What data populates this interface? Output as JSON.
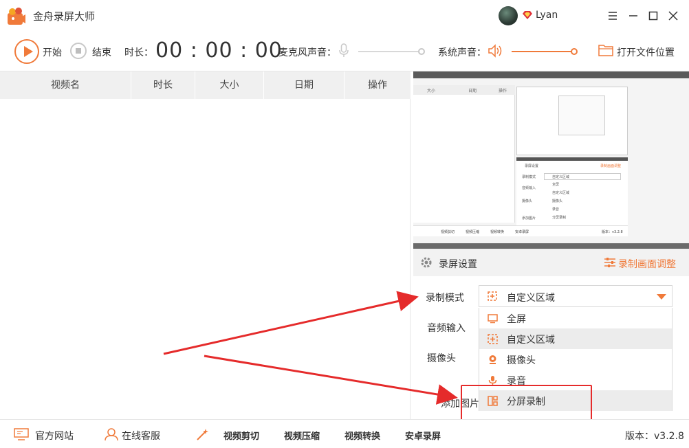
{
  "app": {
    "title": "金舟录屏大师",
    "username": "Lyan"
  },
  "toolbar": {
    "start_label": "开始",
    "stop_label": "结束",
    "duration_label": "时长：",
    "timer": "00 : 00 : 00",
    "mic_label": "麦克风声音：",
    "system_label": "系统声音：",
    "open_folder_label": "打开文件位置"
  },
  "table": {
    "columns": [
      "视频名",
      "时长",
      "大小",
      "日期",
      "操作"
    ]
  },
  "settings": {
    "title": "录屏设置",
    "adjust_label": "录制画面调整",
    "record_mode_label": "录制模式",
    "audio_input_label": "音频输入",
    "camera_label": "摄像头",
    "add_image_label": "添加图片",
    "selected_mode": "自定义区域",
    "options": [
      "全屏",
      "自定义区域",
      "摄像头",
      "录音",
      "分屏录制"
    ]
  },
  "footer": {
    "website": "官方网站",
    "support": "在线客服",
    "video_cut": "视频剪切",
    "video_compress": "视频压缩",
    "video_convert": "视频转换",
    "android_record": "安卓录屏",
    "version": "版本：v3.2.8"
  },
  "preview": {
    "mini_columns": [
      "大小",
      "日期",
      "操作"
    ],
    "mini_options": [
      "全屏",
      "自定义区域",
      "摄像头",
      "录音",
      "分屏录制"
    ],
    "mini_record_mode": "录制模式",
    "mini_audio_input": "音频输入",
    "mini_camera": "摄像头",
    "mini_add_image": "添加图片",
    "mini_selected_mode": "自定义区域",
    "mini_settings_title": "录屏设置",
    "mini_adjust_label": "录制画面调整",
    "mini_footer_items": [
      "视频剪切",
      "视频压缩",
      "视频转换",
      "安卓录屏"
    ],
    "mini_version": "版本：v3.2.8"
  },
  "colors": {
    "accent": "#f07a3a",
    "annotation": "#e52b2b"
  }
}
